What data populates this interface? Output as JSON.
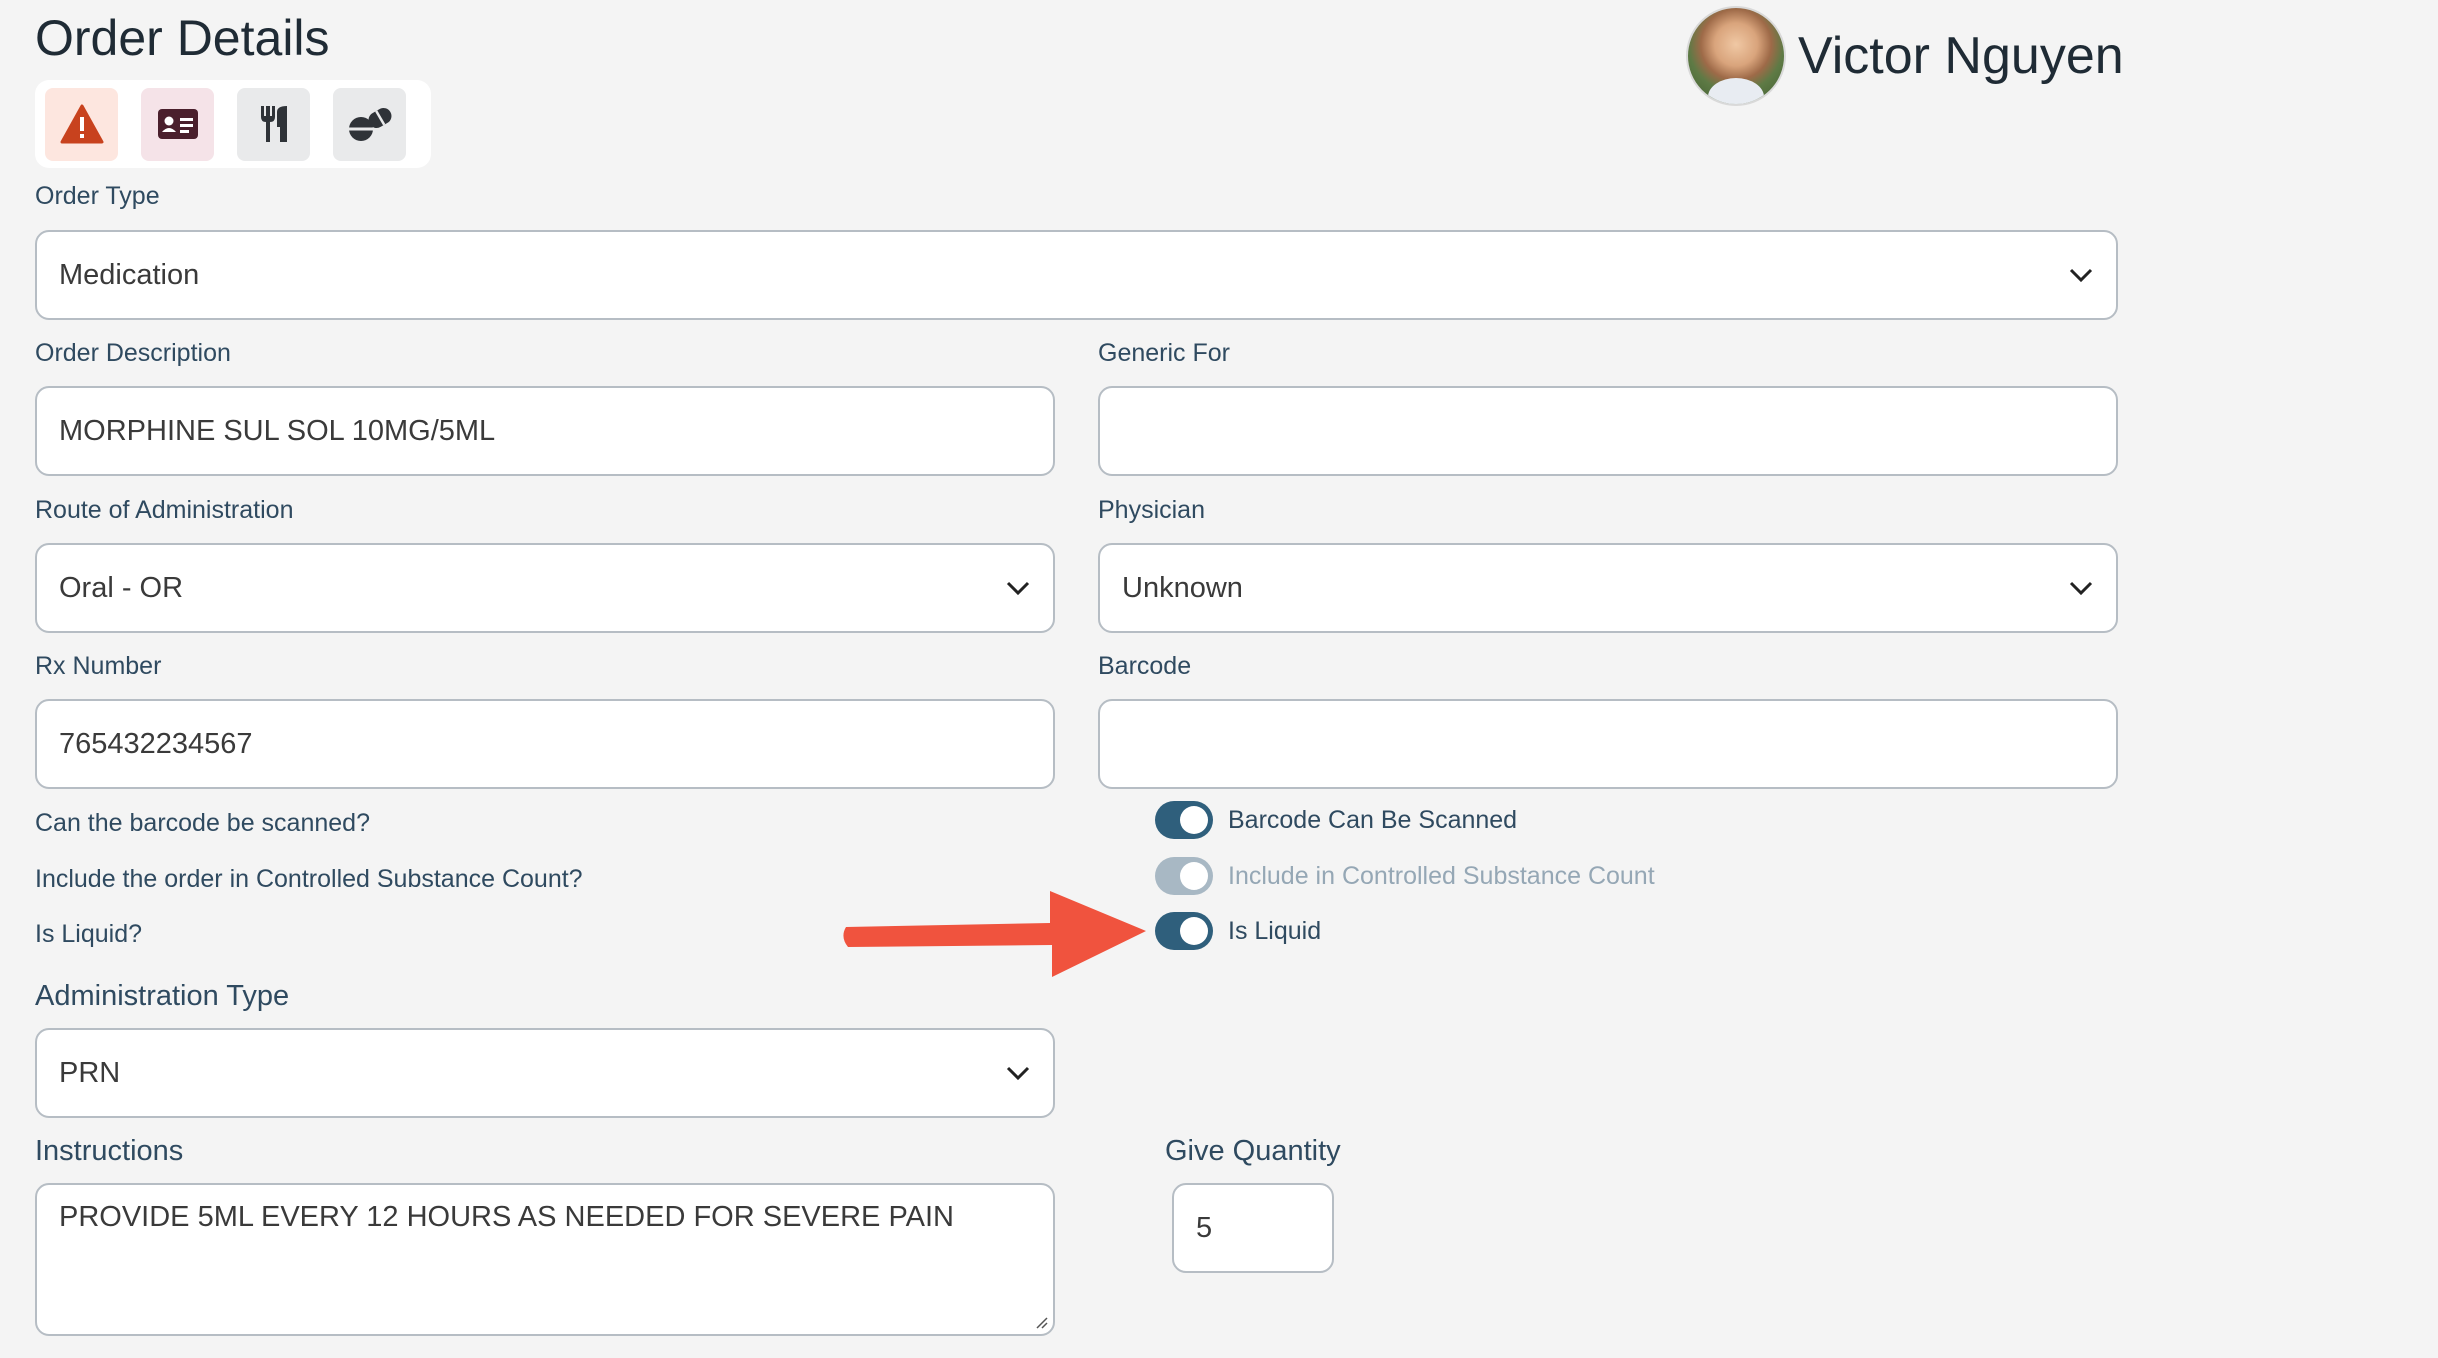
{
  "page": {
    "title": "Order Details"
  },
  "patient": {
    "name": "Victor Nguyen"
  },
  "toolbar": {
    "icons": [
      "warning-icon",
      "id-card-icon",
      "utensils-icon",
      "pills-icon"
    ]
  },
  "form": {
    "order_type": {
      "label": "Order Type",
      "value": "Medication"
    },
    "order_description": {
      "label": "Order Description",
      "value": "MORPHINE SUL SOL 10MG/5ML"
    },
    "generic_for": {
      "label": "Generic For",
      "value": ""
    },
    "route": {
      "label": "Route of Administration",
      "value": "Oral - OR"
    },
    "physician": {
      "label": "Physician",
      "value": "Unknown"
    },
    "rx_number": {
      "label": "Rx Number",
      "value": "765432234567"
    },
    "barcode": {
      "label": "Barcode",
      "value": ""
    },
    "barcode_scan": {
      "question": "Can the barcode be scanned?",
      "toggle_label": "Barcode Can Be Scanned",
      "on": true
    },
    "controlled_count": {
      "question": "Include the order in Controlled Substance Count?",
      "toggle_label": "Include in Controlled Substance Count",
      "on": true,
      "disabled": true
    },
    "is_liquid": {
      "question": "Is Liquid?",
      "toggle_label": "Is Liquid",
      "on": true
    },
    "administration_type": {
      "label": "Administration Type",
      "value": "PRN"
    },
    "instructions": {
      "label": "Instructions",
      "value": "PROVIDE 5ML EVERY 12 HOURS AS NEEDED FOR SEVERE PAIN"
    },
    "give_quantity": {
      "label": "Give Quantity",
      "value": "5"
    }
  },
  "colors": {
    "accent": "#2f5f7c",
    "label": "#2f4a60",
    "annotation_arrow": "#f0533e"
  }
}
